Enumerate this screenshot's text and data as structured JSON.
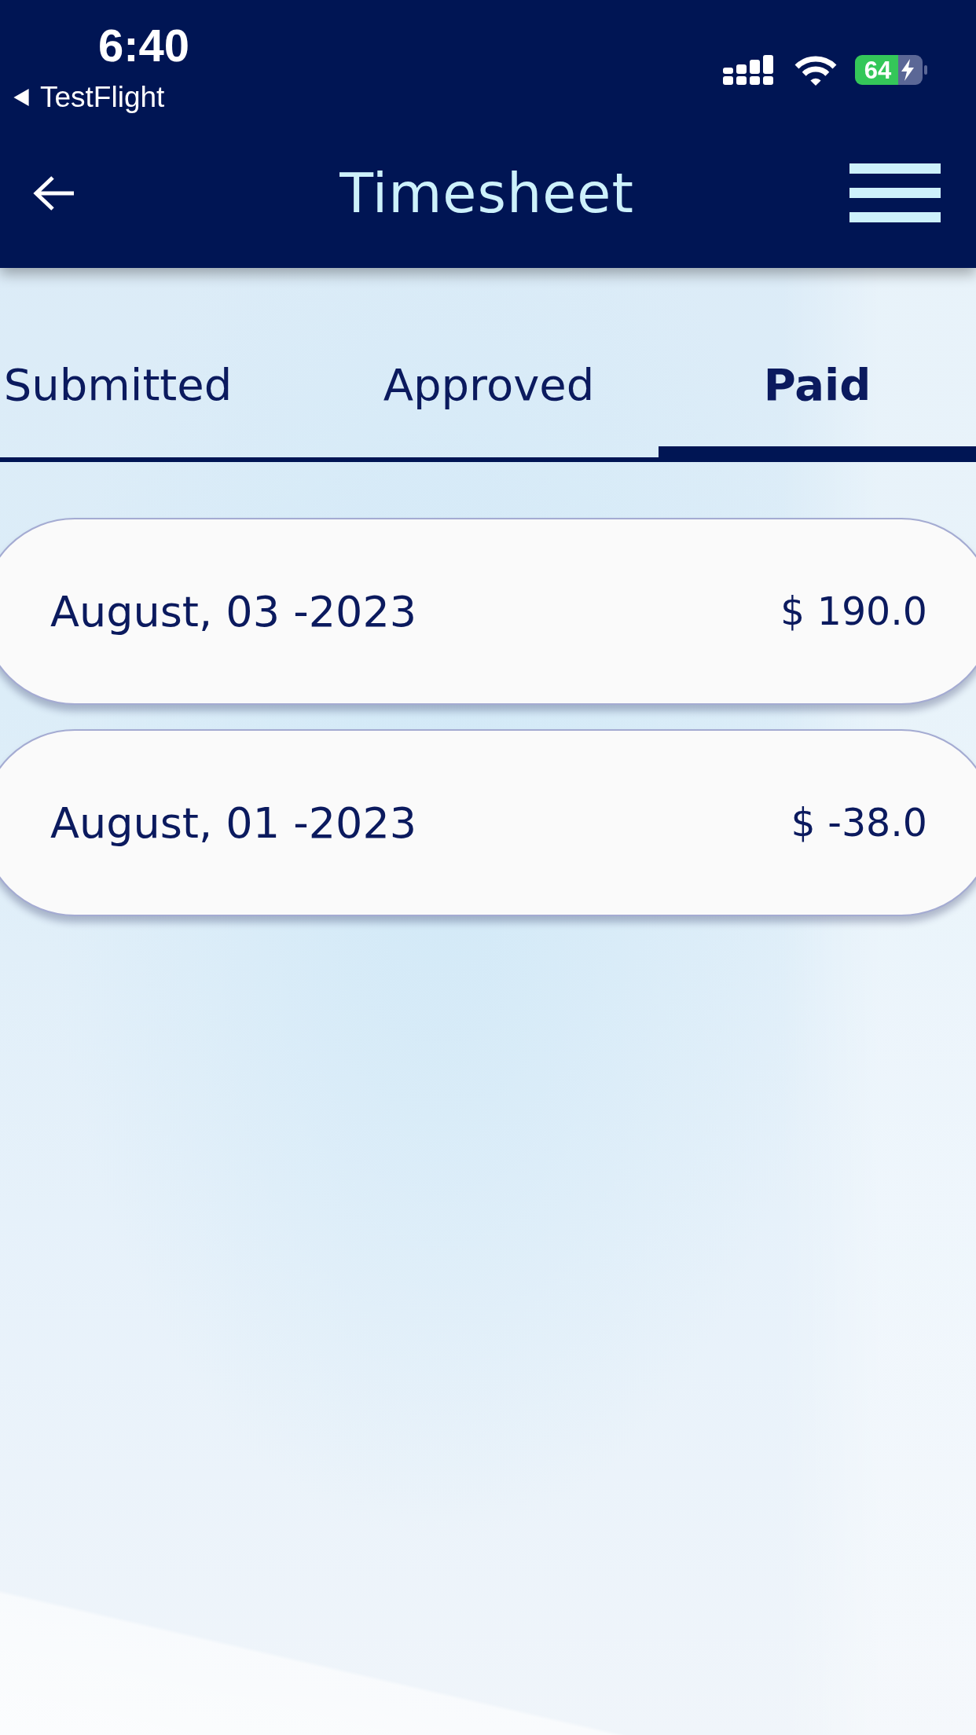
{
  "status_bar": {
    "time": "6:40",
    "back_label": "TestFlight",
    "battery": "64"
  },
  "header": {
    "title": "Timesheet"
  },
  "tabs": [
    {
      "label": "Submitted",
      "selected": false
    },
    {
      "label": "Approved",
      "selected": false
    },
    {
      "label": "Paid",
      "selected": true
    }
  ],
  "entries": [
    {
      "date": "August, 03 -2023",
      "amount": "$ 190.0"
    },
    {
      "date": "August, 01 -2023",
      "amount": "$ -38.0"
    }
  ]
}
